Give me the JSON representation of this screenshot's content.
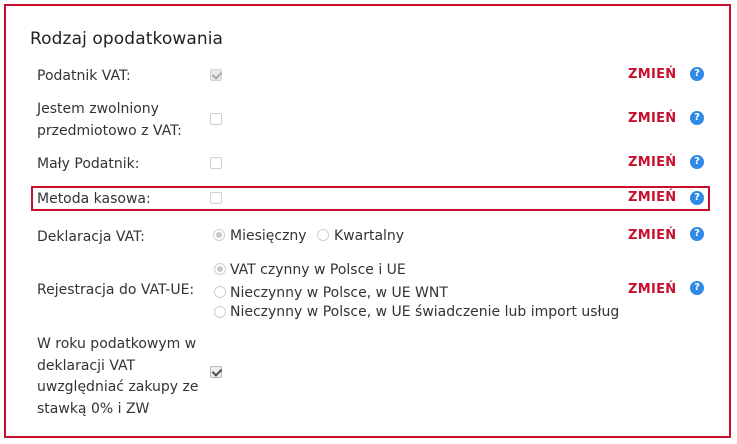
{
  "section": {
    "title": "Rodzaj opodatkowania"
  },
  "rows": {
    "vat": {
      "label": "Podatnik VAT:",
      "checked": true,
      "disabled": true
    },
    "zwolniony": {
      "label_line1": "Jestem zwolniony",
      "label_line2": "przedmiotowo z VAT:",
      "checked": false
    },
    "maly": {
      "label": "Mały Podatnik:",
      "checked": false
    },
    "kasowa": {
      "label": "Metoda kasowa:",
      "checked": false,
      "highlighted": true
    },
    "deklaracja": {
      "label": "Deklaracja VAT:",
      "options": [
        "Miesięczny",
        "Kwartalny"
      ],
      "selected": "Miesięczny"
    },
    "vatue": {
      "label": "Rejestracja do VAT-UE:",
      "options": [
        "VAT czynny w Polsce i UE",
        "Nieczynny w Polsce, w UE WNT",
        "Nieczynny w Polsce, w UE świadczenie lub import usług"
      ],
      "selected": "VAT czynny w Polsce i UE"
    },
    "zakupy": {
      "label_lines": [
        "W roku podatkowym w",
        "deklaracji VAT",
        "uwzględniać zakupy ze",
        "stawką 0% i ZW"
      ],
      "checked": true
    }
  },
  "action_label": "ZMIEŃ",
  "help_glyph": "?",
  "help_icon": "question-circle-icon",
  "colors": {
    "accent": "#c8102e",
    "help": "#2e8ae6"
  }
}
